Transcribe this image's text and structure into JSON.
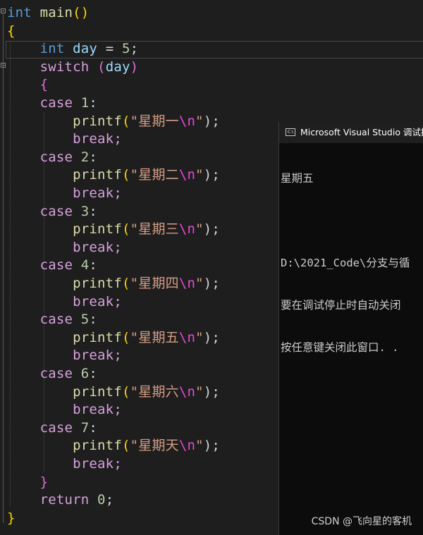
{
  "code": {
    "line1": {
      "kw": "int",
      "name": "main",
      "open": "(",
      "close": ")"
    },
    "line2": {
      "brace": "{"
    },
    "line3": {
      "kw": "int",
      "var": "day",
      "op": "=",
      "num": "5",
      "semi": ";"
    },
    "line4": {
      "kw": "switch",
      "open": "(",
      "var": "day",
      "close": ")"
    },
    "line5": {
      "brace": "{"
    },
    "cases": [
      {
        "kw": "case",
        "num": "1",
        "colon": ":",
        "fn": "printf",
        "str": "\"星期一",
        "esc": "\\n",
        "strend": "\"",
        "end": ");",
        "brk": "break;"
      },
      {
        "kw": "case",
        "num": "2",
        "colon": ":",
        "fn": "printf",
        "str": "\"星期二",
        "esc": "\\n",
        "strend": "\"",
        "end": ");",
        "brk": "break;"
      },
      {
        "kw": "case",
        "num": "3",
        "colon": ":",
        "fn": "printf",
        "str": "\"星期三",
        "esc": "\\n",
        "strend": "\"",
        "end": ");",
        "brk": "break;"
      },
      {
        "kw": "case",
        "num": "4",
        "colon": ":",
        "fn": "printf",
        "str": "\"星期四",
        "esc": "\\n",
        "strend": "\"",
        "end": ");",
        "brk": "break;"
      },
      {
        "kw": "case",
        "num": "5",
        "colon": ":",
        "fn": "printf",
        "str": "\"星期五",
        "esc": "\\n",
        "strend": "\"",
        "end": ");",
        "brk": "break;"
      },
      {
        "kw": "case",
        "num": "6",
        "colon": ":",
        "fn": "printf",
        "str": "\"星期六",
        "esc": "\\n",
        "strend": "\"",
        "end": ");",
        "brk": "break;"
      },
      {
        "kw": "case",
        "num": "7",
        "colon": ":",
        "fn": "printf",
        "str": "\"星期天",
        "esc": "\\n",
        "strend": "\"",
        "end": ");",
        "brk": "break;"
      }
    ],
    "close_switch": "}",
    "ret": {
      "kw": "return",
      "num": "0",
      "semi": ";"
    },
    "close_main": "}"
  },
  "console": {
    "title": "Microsoft Visual Studio 调试控",
    "icon_label": "C:\\",
    "lines": [
      "星期五",
      "",
      "D:\\2021_Code\\分支与循",
      "要在调试停止时自动关闭",
      "按任意键关闭此窗口. ."
    ]
  },
  "watermark": "CSDN @飞向星的客机"
}
